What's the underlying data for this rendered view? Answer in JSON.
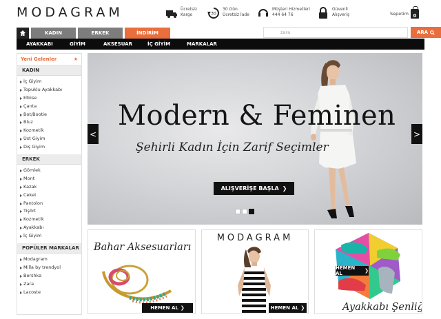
{
  "brand": {
    "logo": "MODAGRAM",
    "logo_small": "MODAGRAM"
  },
  "features": [
    {
      "icon": "truck-icon",
      "line1": "Ücretsiz",
      "line2": "Kargo"
    },
    {
      "icon": "return-icon",
      "line1": "30 Gün",
      "line2": "Ücretsiz İade"
    },
    {
      "icon": "headset-icon",
      "line1": "Müşteri Hizmetleri",
      "line2": "444 64 76"
    },
    {
      "icon": "lock-icon",
      "line1": "Güvenli",
      "line2": "Alışveriş"
    }
  ],
  "cart": {
    "label": "Sepetim",
    "count": "0"
  },
  "tabs": {
    "home_icon": "home-icon",
    "women": "KADIN",
    "men": "ERKEK",
    "sale": "İNDİRİM"
  },
  "search": {
    "placeholder": "zara",
    "button": "ARA"
  },
  "catnav": [
    "AYAKKABI",
    "GİYİM",
    "AKSESUAR",
    "İÇ GİYİM",
    "MARKALAR"
  ],
  "sidebar": {
    "new_arrivals": "Yeni Gelenler",
    "women": {
      "title": "KADIN",
      "items": [
        "İç Giyim",
        "Topuklu Ayakkabı",
        "Elbise",
        "Çanta",
        "Bot/Bootie",
        "Bluz",
        "Kozmetik",
        "Üst Giyim",
        "Dış Giyim"
      ]
    },
    "men": {
      "title": "ERKEK",
      "items": [
        "Gömlek",
        "Mont",
        "Kazak",
        "Ceket",
        "Pantolon",
        "Tişört",
        "Kozmetik",
        "Ayakkabı",
        "İç Giyim"
      ]
    },
    "brands": {
      "title": "POPÜLER MARKALAR",
      "items": [
        "Modagram",
        "Milla by trendyol",
        "Bershka",
        "Zara",
        "Lacoste"
      ]
    }
  },
  "hero": {
    "title": "Modern & Feminen",
    "subtitle": "Şehirli Kadın İçin Zarif Seçimler",
    "button": "ALIŞVERİŞE BAŞLA",
    "prev": "<",
    "next": ">",
    "slides": 3,
    "active_slide": 3
  },
  "promos": {
    "accessories": {
      "title": "Bahar Aksesuarları",
      "button": "HEMEN AL"
    },
    "fashion": {
      "title": "MODAGRAM",
      "button": "HEMEN AL"
    },
    "shoes": {
      "title": "Ayakkabı Şenliği",
      "button": "HEMEN AL"
    }
  },
  "colors": {
    "accent": "#e96e3c",
    "dark": "#0c0c0c",
    "tab_gray": "#7d7d7d"
  }
}
